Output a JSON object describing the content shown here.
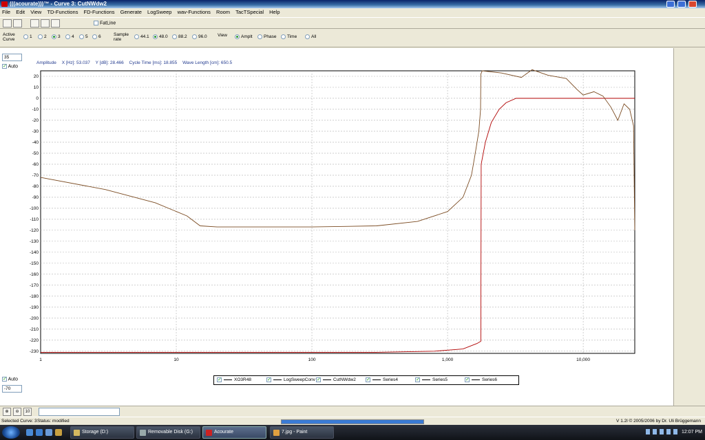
{
  "window": {
    "title": "(((acourate)))™ - Curve 3: CutNWdw2"
  },
  "menu": [
    "File",
    "Edit",
    "View",
    "TD-Functions",
    "FD-Functions",
    "Generate",
    "LogSweep",
    "wav-Functions",
    "Room",
    "TacTSpecial",
    "Help"
  ],
  "toolbar": {
    "fatline_label": "FatLine",
    "fatline_checked": false
  },
  "options": {
    "active_curve_label": "Active Curve",
    "curves": [
      {
        "label": "1",
        "selected": false
      },
      {
        "label": "2",
        "selected": false
      },
      {
        "label": "3",
        "selected": true
      },
      {
        "label": "4",
        "selected": false
      },
      {
        "label": "5",
        "selected": false
      },
      {
        "label": "6",
        "selected": false
      }
    ],
    "sample_rate_label": "Sample rate",
    "sample_rates": [
      {
        "label": "44.1",
        "selected": false
      },
      {
        "label": "48.0",
        "selected": true
      },
      {
        "label": "88.2",
        "selected": false
      },
      {
        "label": "96.0",
        "selected": false
      }
    ],
    "view_label": "View",
    "views": [
      {
        "label": "Amplt",
        "selected": true
      },
      {
        "label": "Phase",
        "selected": false
      },
      {
        "label": "Time",
        "selected": false
      },
      {
        "label": "All",
        "selected": false
      }
    ]
  },
  "left_panel": {
    "ymax_value": "35",
    "auto_top_label": "Auto",
    "auto_bottom_label": "Auto",
    "ymin_value": "-70"
  },
  "info": {
    "amplitude": "Amplitude",
    "x": "X [Hz]: 53.037",
    "y": "Y [dB]: 28.466",
    "cycle": "Cycle Time [ms]: 18.855",
    "wavelength": "Wave Length [cm]: 650.5"
  },
  "chart_data": {
    "type": "line",
    "x_scale": "log",
    "xlim": [
      1,
      24000
    ],
    "ylim": [
      -232,
      25
    ],
    "x_ticks": [
      "1",
      "10",
      "100",
      "1,000",
      "10,000"
    ],
    "y_ticks": [
      "20",
      "10",
      "0",
      "-10",
      "-20",
      "-30",
      "-40",
      "-50",
      "-60",
      "-70",
      "-80",
      "-90",
      "-100",
      "-110",
      "-120",
      "-130",
      "-140",
      "-150",
      "-160",
      "-170",
      "-180",
      "-190",
      "-200",
      "-210",
      "-220",
      "-230"
    ],
    "grid": true,
    "legend_position": "bottom",
    "series": [
      {
        "name": "XO3R48",
        "color": "#b00000",
        "points": [
          [
            1,
            -231
          ],
          [
            300,
            -231
          ],
          [
            800,
            -230
          ],
          [
            1300,
            -228
          ],
          [
            1650,
            -223
          ],
          [
            1760,
            -221
          ],
          [
            1770,
            -60
          ],
          [
            1900,
            -40
          ],
          [
            2100,
            -22
          ],
          [
            2400,
            -10
          ],
          [
            2700,
            -4
          ],
          [
            3200,
            0
          ],
          [
            24000,
            0
          ]
        ]
      },
      {
        "name": "LogSweepConv",
        "color": "#7a4a20",
        "points": [
          [
            1,
            -72
          ],
          [
            3,
            -83
          ],
          [
            7,
            -95
          ],
          [
            12,
            -107
          ],
          [
            15,
            -116
          ],
          [
            20,
            -117
          ],
          [
            100,
            -117
          ],
          [
            300,
            -116
          ],
          [
            600,
            -112
          ],
          [
            1000,
            -103
          ],
          [
            1300,
            -90
          ],
          [
            1500,
            -70
          ],
          [
            1600,
            -50
          ],
          [
            1700,
            -30
          ],
          [
            1750,
            -10
          ],
          [
            1760,
            22
          ],
          [
            1800,
            25
          ],
          [
            2500,
            23
          ],
          [
            3500,
            19
          ],
          [
            4200,
            26
          ],
          [
            5500,
            21
          ],
          [
            7500,
            18
          ],
          [
            9000,
            8
          ],
          [
            10000,
            3
          ],
          [
            12000,
            6
          ],
          [
            14000,
            2
          ],
          [
            16000,
            -8
          ],
          [
            18000,
            -20
          ],
          [
            20000,
            -5
          ],
          [
            22000,
            -10
          ],
          [
            23500,
            -25
          ],
          [
            24000,
            -120
          ]
        ]
      },
      {
        "name": "CutNWdw2",
        "color": "#000000",
        "points": []
      },
      {
        "name": "Series4",
        "color": "#000000",
        "points": []
      },
      {
        "name": "Series5",
        "color": "#000000",
        "points": []
      },
      {
        "name": "Series6",
        "color": "#000000",
        "points": []
      }
    ]
  },
  "bottom": {
    "zoom_step": "10"
  },
  "status": {
    "selected_curve": "Selected Curve: 3",
    "status_text": "Status: modified",
    "progress": 1.0,
    "version": "V 1.2l © 2005/2006 by Dr. Uli Brüggemann"
  },
  "taskbar": {
    "items": [
      {
        "label": "Storage (D:)",
        "active": false
      },
      {
        "label": "Removable Disk (G:)",
        "active": false
      },
      {
        "label": "Acourate",
        "active": true
      },
      {
        "label": "7.jpg - Paint",
        "active": false
      }
    ],
    "clock": "12:07 PM"
  }
}
